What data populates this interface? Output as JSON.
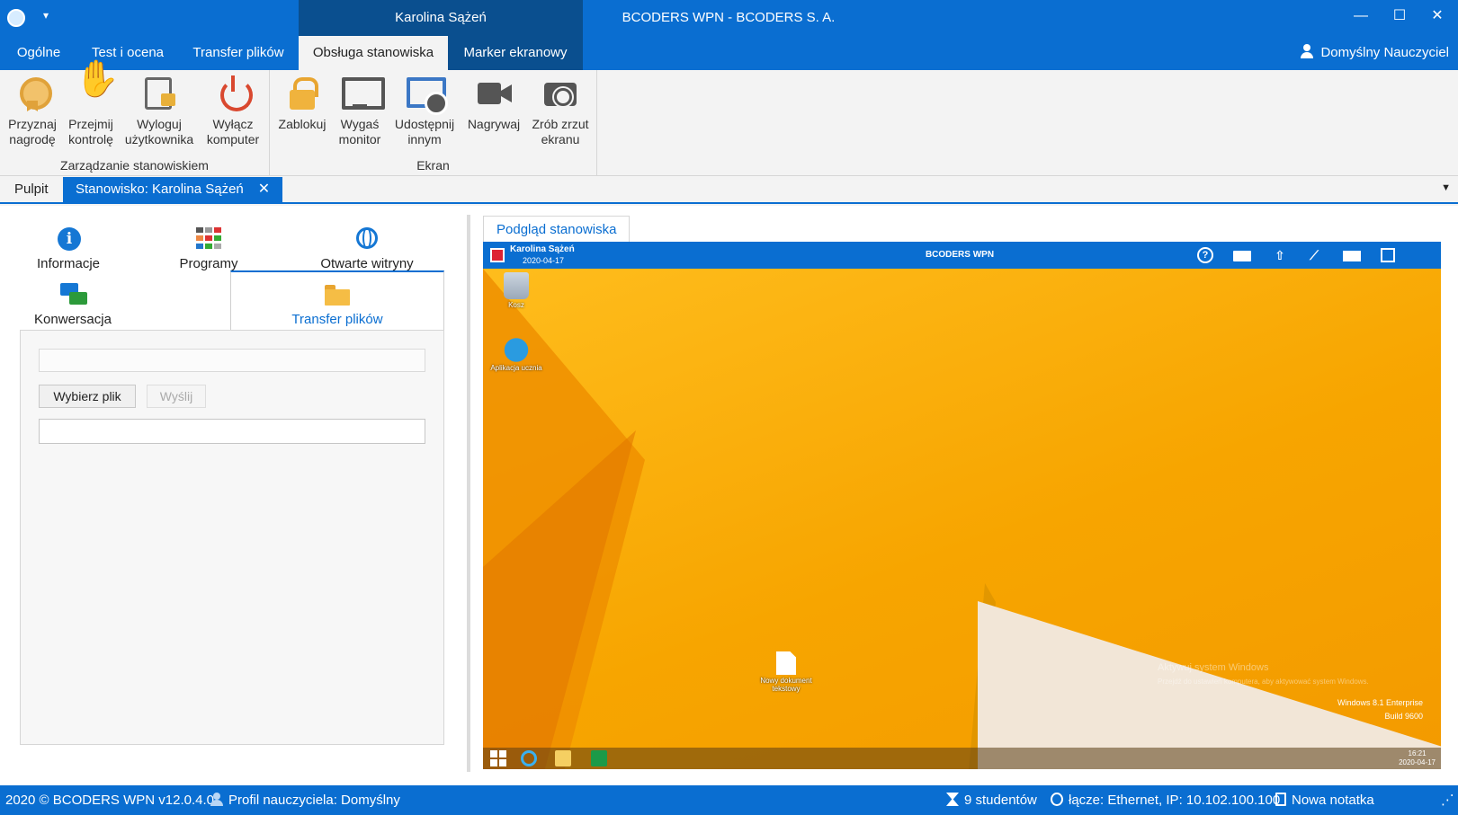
{
  "titlebar": {
    "context_title": "Karolina Sążeń",
    "window_title": "BCODERS WPN - BCODERS S. A.",
    "quick_access": "▾",
    "minimize": "—",
    "maximize": "☐",
    "close": "✕"
  },
  "ribbon_tabs": {
    "items": [
      {
        "label": "Ogólne"
      },
      {
        "label": "Test i ocena"
      },
      {
        "label": "Transfer plików"
      },
      {
        "label": "Obsługa stanowiska"
      },
      {
        "label": "Marker ekranowy"
      }
    ],
    "active_index": 3,
    "user": "Domyślny Nauczyciel"
  },
  "ribbon": {
    "groups": [
      {
        "label": "Zarządzanie stanowiskiem",
        "buttons": [
          {
            "label": "Przyznaj\nnagrodę",
            "icon": "medal-icon"
          },
          {
            "label": "Przejmij\nkontrolę",
            "icon": "hand-icon"
          },
          {
            "label": "Wyloguj\nużytkownika",
            "icon": "logout-user-icon"
          },
          {
            "label": "Wyłącz\nkomputer",
            "icon": "power-icon"
          }
        ]
      },
      {
        "label": "Ekran",
        "buttons": [
          {
            "label": "Zablokuj",
            "icon": "lock-icon"
          },
          {
            "label": "Wygaś\nmonitor",
            "icon": "monitor-icon"
          },
          {
            "label": "Udostępnij\ninnym",
            "icon": "share-screen-icon"
          },
          {
            "label": "Nagrywaj",
            "icon": "video-camera-icon"
          },
          {
            "label": "Zrób zrzut\nekranu",
            "icon": "camera-icon"
          }
        ]
      }
    ]
  },
  "doc_tabs": {
    "items": [
      {
        "label": "Pulpit"
      },
      {
        "label": "Stanowisko: Karolina Sążeń",
        "closable": true
      }
    ],
    "active_index": 1,
    "close_glyph": "✕",
    "dropdown_glyph": "▼"
  },
  "station": {
    "tabs": [
      {
        "label": "Informacje",
        "icon": "info-icon"
      },
      {
        "label": "Programy",
        "icon": "apps-grid-icon"
      },
      {
        "label": "Otwarte witryny",
        "icon": "globe-icon"
      },
      {
        "label": "Konwersacja",
        "icon": "chat-icon"
      },
      {
        "label": "Transfer plików",
        "icon": "folder-open-icon"
      }
    ],
    "active_index": 4,
    "transfer": {
      "path_value": "",
      "choose_file": "Wybierz plik",
      "send": "Wyślij",
      "message_value": ""
    }
  },
  "preview": {
    "tab_label": "Podgląd stanowiska",
    "student_name": "Karolina Sążeń",
    "date": "2020-04-17",
    "bar_title": "BCODERS WPN",
    "bar_icons": [
      "help-icon",
      "folder-icon",
      "upload-icon",
      "chart-icon",
      "mail-icon",
      "note-icon"
    ],
    "desktop_icons": [
      {
        "label": "Kosz"
      },
      {
        "label": "Aplikacja ucznia"
      },
      {
        "label": "Nowy dokument tekstowy"
      }
    ],
    "watermark_title": "Aktywuj system Windows",
    "watermark_text": "Przejdź do ustawień komputera, aby aktywować system Windows.",
    "edition": "Windows 8.1 Enterprise",
    "build": "Build 9600",
    "clock_time": "16:21",
    "clock_date": "2020-04-17"
  },
  "statusbar": {
    "copyright": "2020 ©  BCODERS WPN v12.0.4.0",
    "profile": "Profil nauczyciela: Domyślny",
    "students": "9 studentów",
    "connection": "łącze: Ethernet, IP: 10.102.100.100",
    "note": "Nowa notatka",
    "grip": "⋰"
  },
  "colors": {
    "accent": "#0a6ed1",
    "accent_dark": "#0a4f8f",
    "desktop": "#f6a800"
  }
}
